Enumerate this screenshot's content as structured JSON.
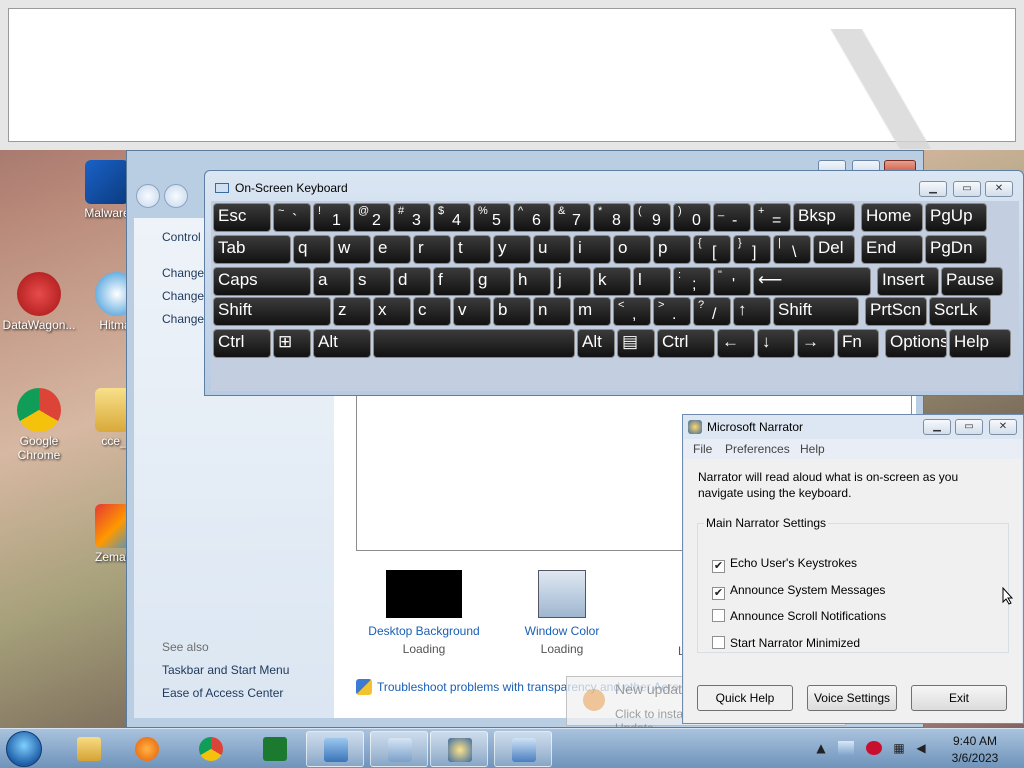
{
  "desktop": {
    "icons": [
      {
        "label": "Malwarebytes",
        "visible": "Malware"
      },
      {
        "label": "DataWagon",
        "visible": "DataWagon..."
      },
      {
        "label": "Hitman",
        "visible": "Hitmar"
      },
      {
        "label": "Google Chrome",
        "visible": "Google Chrome"
      },
      {
        "label": "cce",
        "visible": "cce_x"
      },
      {
        "label": "Zemana",
        "visible": "Zemana"
      }
    ]
  },
  "control_panel": {
    "sidebar": {
      "home": "Control",
      "links": [
        "Change",
        "Change",
        "Change"
      ],
      "see_also": "See also",
      "see_also_links": [
        "Taskbar and Start Menu",
        "Ease of Access Center"
      ]
    },
    "items": [
      {
        "label": "Desktop Background",
        "status": "Loading"
      },
      {
        "label": "Window Color",
        "status": "Loading"
      }
    ],
    "partial_status": "L",
    "troubleshoot": "Troubleshoot problems with transparency and other Aero"
  },
  "osk": {
    "title": "On-Screen Keyboard",
    "rows": [
      [
        {
          "m": "Esc"
        },
        {
          "s": "~",
          "m": "`"
        },
        {
          "s": "!",
          "m": "1"
        },
        {
          "s": "@",
          "m": "2"
        },
        {
          "s": "#",
          "m": "3"
        },
        {
          "s": "$",
          "m": "4"
        },
        {
          "s": "%",
          "m": "5"
        },
        {
          "s": "^",
          "m": "6"
        },
        {
          "s": "&",
          "m": "7"
        },
        {
          "s": "*",
          "m": "8"
        },
        {
          "s": "(",
          "m": "9"
        },
        {
          "s": ")",
          "m": "0"
        },
        {
          "s": "_",
          "m": "-"
        },
        {
          "s": "+",
          "m": "="
        },
        {
          "m": "Bksp"
        },
        {
          "m": "Home"
        },
        {
          "m": "PgUp"
        }
      ],
      [
        {
          "m": "Tab"
        },
        {
          "m": "q"
        },
        {
          "m": "w"
        },
        {
          "m": "e"
        },
        {
          "m": "r"
        },
        {
          "m": "t"
        },
        {
          "m": "y"
        },
        {
          "m": "u"
        },
        {
          "m": "i"
        },
        {
          "m": "o"
        },
        {
          "m": "p"
        },
        {
          "s": "{",
          "m": "["
        },
        {
          "s": "}",
          "m": "]"
        },
        {
          "s": "|",
          "m": "\\"
        },
        {
          "m": "Del"
        },
        {
          "m": "End"
        },
        {
          "m": "PgDn"
        }
      ],
      [
        {
          "m": "Caps"
        },
        {
          "m": "a"
        },
        {
          "m": "s"
        },
        {
          "m": "d"
        },
        {
          "m": "f"
        },
        {
          "m": "g"
        },
        {
          "m": "h"
        },
        {
          "m": "j"
        },
        {
          "m": "k"
        },
        {
          "m": "l"
        },
        {
          "s": ":",
          "m": ";"
        },
        {
          "s": "\"",
          "m": "'"
        },
        {
          "m": "⟵"
        },
        {
          "m": "Insert"
        },
        {
          "m": "Pause"
        }
      ],
      [
        {
          "m": "Shift"
        },
        {
          "m": "z"
        },
        {
          "m": "x"
        },
        {
          "m": "c"
        },
        {
          "m": "v"
        },
        {
          "m": "b"
        },
        {
          "m": "n"
        },
        {
          "m": "m"
        },
        {
          "s": "<",
          "m": ","
        },
        {
          "s": ">",
          "m": "."
        },
        {
          "s": "?",
          "m": "/"
        },
        {
          "m": "↑"
        },
        {
          "m": "Shift"
        },
        {
          "m": "PrtScn"
        },
        {
          "m": "ScrLk"
        }
      ],
      [
        {
          "m": "Ctrl"
        },
        {
          "m": "⊞"
        },
        {
          "m": "Alt"
        },
        {
          "m": ""
        },
        {
          "m": "Alt"
        },
        {
          "m": "▤"
        },
        {
          "m": "Ctrl"
        },
        {
          "m": "←"
        },
        {
          "m": "↓"
        },
        {
          "m": "→"
        },
        {
          "m": "Fn"
        },
        {
          "m": "Options"
        },
        {
          "m": "Help"
        }
      ]
    ]
  },
  "narrator": {
    "title": "Microsoft Narrator",
    "menu": [
      "File",
      "Preferences",
      "Help"
    ],
    "description": "Narrator will read aloud what is on-screen as you navigate using the keyboard.",
    "group_title": "Main Narrator Settings",
    "options": [
      {
        "label": "Echo User's Keystrokes",
        "checked": true
      },
      {
        "label": "Announce System Messages",
        "checked": true
      },
      {
        "label": "Announce Scroll Notifications",
        "checked": false
      },
      {
        "label": "Start Narrator Minimized",
        "checked": false
      }
    ],
    "buttons": {
      "quick_help": "Quick Help",
      "voice_settings": "Voice Settings",
      "exit": "Exit"
    }
  },
  "notification": {
    "title": "New updates are available",
    "title_visible": "New updates a",
    "body": "Click to install them using Windows Update."
  },
  "taskbar": {
    "time": "9:40 AM",
    "date": "3/6/2023"
  }
}
